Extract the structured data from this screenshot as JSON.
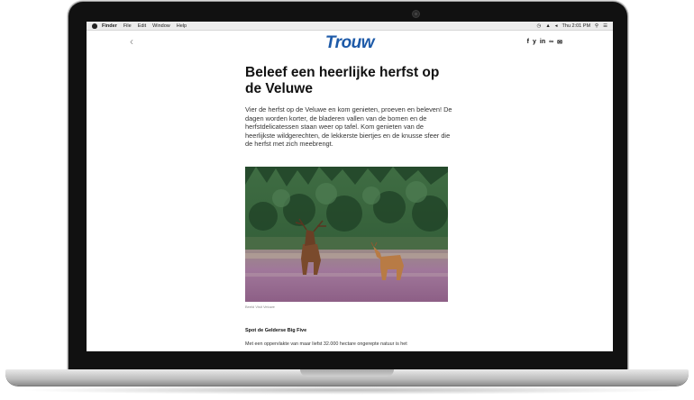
{
  "menubar": {
    "app": "Finder",
    "items": [
      "File",
      "Edit",
      "Window",
      "Help"
    ],
    "time": "Thu 2:01 PM"
  },
  "site": {
    "back": "‹",
    "logo": "Trouw",
    "share": [
      "f",
      "y",
      "in",
      "∞",
      "✉"
    ]
  },
  "article": {
    "title": "Beleef een heerlijke herfst op de Veluwe",
    "lead": "Vier de herfst op de Veluwe en kom genieten, proeven en beleven! De dagen worden korter, de bladeren vallen van de bomen en de herfstdelicatessen staan weer op tafel. Kom genieten van de heerlijkste wildgerechten, de lekkerste biertjes en de knusse sfeer die de herfst met zich meebrengt.",
    "photo_caption": "Beeld Visit Veluwe",
    "subhead": "Spot de Gelderse Big Five",
    "body": "Met een oppervlakte van maar liefst 32.000 hectare ongerepte natuur is het"
  },
  "colors": {
    "logo": "#1d5aa8",
    "forest": "#2f5a35",
    "heather": "#a97a9a"
  }
}
